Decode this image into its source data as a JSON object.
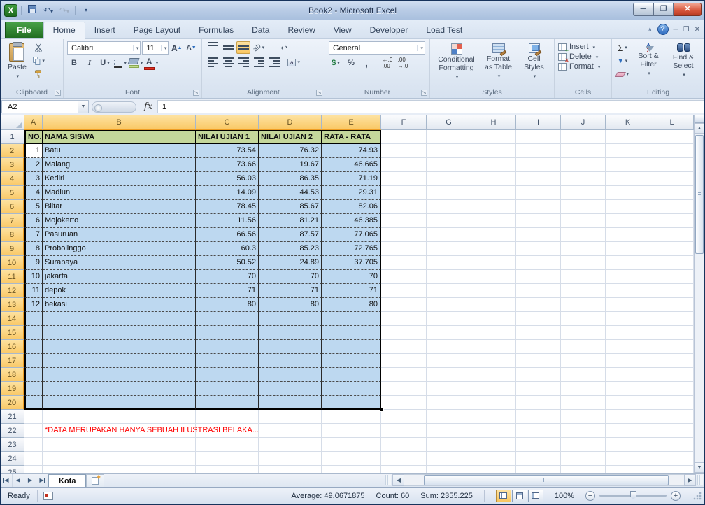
{
  "window": {
    "title": "Book2  -  Microsoft Excel"
  },
  "ribbon_tabs": [
    {
      "label": "File",
      "type": "file",
      "active": false
    },
    {
      "label": "Home",
      "type": "normal",
      "active": true
    },
    {
      "label": "Insert",
      "type": "normal",
      "active": false
    },
    {
      "label": "Page Layout",
      "type": "normal",
      "active": false
    },
    {
      "label": "Formulas",
      "type": "normal",
      "active": false
    },
    {
      "label": "Data",
      "type": "normal",
      "active": false
    },
    {
      "label": "Review",
      "type": "normal",
      "active": false
    },
    {
      "label": "View",
      "type": "normal",
      "active": false
    },
    {
      "label": "Developer",
      "type": "normal",
      "active": false
    },
    {
      "label": "Load Test",
      "type": "normal",
      "active": false
    }
  ],
  "ribbon": {
    "clipboard": {
      "label": "Clipboard",
      "paste": "Paste"
    },
    "font": {
      "label": "Font",
      "family": "Calibri",
      "size": "11"
    },
    "alignment": {
      "label": "Alignment"
    },
    "number": {
      "label": "Number",
      "format": "General"
    },
    "styles": {
      "label": "Styles",
      "conditional": "Conditional Formatting",
      "format_table": "Format as Table",
      "cell_styles": "Cell Styles"
    },
    "cells": {
      "label": "Cells",
      "insert": "Insert",
      "delete": "Delete",
      "format": "Format"
    },
    "editing": {
      "label": "Editing",
      "sort_filter": "Sort & Filter",
      "find_select": "Find & Select"
    }
  },
  "formula_bar": {
    "name_box": "A2",
    "fx": "fx",
    "value": "1"
  },
  "grid": {
    "columns": [
      {
        "letter": "A",
        "selected": true
      },
      {
        "letter": "B",
        "selected": true
      },
      {
        "letter": "C",
        "selected": true
      },
      {
        "letter": "D",
        "selected": true
      },
      {
        "letter": "E",
        "selected": true
      },
      {
        "letter": "F",
        "selected": false
      },
      {
        "letter": "G",
        "selected": false
      },
      {
        "letter": "H",
        "selected": false
      },
      {
        "letter": "I",
        "selected": false
      },
      {
        "letter": "J",
        "selected": false
      },
      {
        "letter": "K",
        "selected": false
      },
      {
        "letter": "L",
        "selected": false
      }
    ],
    "visible_rows": 25,
    "selection": {
      "range": "A2:E20",
      "active_cell": "A2",
      "selected_row_start": 2,
      "selected_row_end": 20
    },
    "table": {
      "headers": [
        "NO.",
        "NAMA SISWA",
        "NILAI UJIAN 1",
        "NILAI UJIAN 2",
        "RATA - RATA"
      ],
      "rows": [
        {
          "no": "1",
          "name": "Batu",
          "nilai1": "73.54",
          "nilai2": "76.32",
          "rata": "74.93"
        },
        {
          "no": "2",
          "name": "Malang",
          "nilai1": "73.66",
          "nilai2": "19.67",
          "rata": "46.665"
        },
        {
          "no": "3",
          "name": "Kediri",
          "nilai1": "56.03",
          "nilai2": "86.35",
          "rata": "71.19"
        },
        {
          "no": "4",
          "name": "Madiun",
          "nilai1": "14.09",
          "nilai2": "44.53",
          "rata": "29.31"
        },
        {
          "no": "5",
          "name": "Blitar",
          "nilai1": "78.45",
          "nilai2": "85.67",
          "rata": "82.06"
        },
        {
          "no": "6",
          "name": "Mojokerto",
          "nilai1": "11.56",
          "nilai2": "81.21",
          "rata": "46.385"
        },
        {
          "no": "7",
          "name": "Pasuruan",
          "nilai1": "66.56",
          "nilai2": "87.57",
          "rata": "77.065"
        },
        {
          "no": "8",
          "name": "Probolinggo",
          "nilai1": "60.3",
          "nilai2": "85.23",
          "rata": "72.765"
        },
        {
          "no": "9",
          "name": "Surabaya",
          "nilai1": "50.52",
          "nilai2": "24.89",
          "rata": "37.705"
        },
        {
          "no": "10",
          "name": "jakarta",
          "nilai1": "70",
          "nilai2": "70",
          "rata": "70"
        },
        {
          "no": "11",
          "name": "depok",
          "nilai1": "71",
          "nilai2": "71",
          "rata": "71"
        },
        {
          "no": "12",
          "name": "bekasi",
          "nilai1": "80",
          "nilai2": "80",
          "rata": "80"
        }
      ]
    },
    "note": {
      "row": 22,
      "column": "B",
      "text": "*DATA MERUPAKAN HANYA SEBUAH ILUSTRASI BELAKA..."
    }
  },
  "sheet_bar": {
    "tabs": [
      {
        "label": "Kota",
        "active": true
      }
    ]
  },
  "status_bar": {
    "mode": "Ready",
    "average_label": "Average: 49.0671875",
    "count_label": "Count: 60",
    "sum_label": "Sum: 2355.225",
    "zoom_level": "100%"
  },
  "colors": {
    "selection_fill": "#BDD8F0",
    "table_header_fill": "#C4D79B",
    "selected_header_fill": "#FBD16F",
    "note_color": "#FF0000",
    "file_tab_green": "#1E6B1E"
  }
}
